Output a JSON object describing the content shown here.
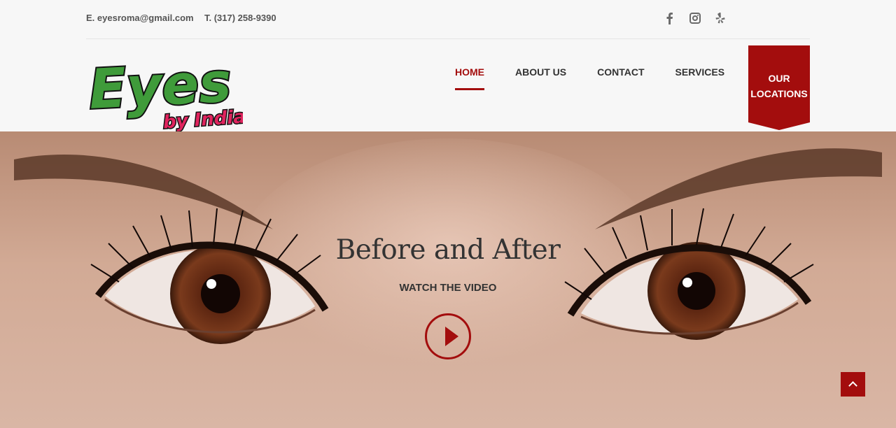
{
  "topbar": {
    "email": "E. eyesroma@gmail.com",
    "phone": "T. (317) 258-9390",
    "social_icons": [
      "facebook-icon",
      "instagram-icon",
      "yelp-icon"
    ]
  },
  "logo": {
    "main": "Eyes",
    "sub": "by India"
  },
  "nav": {
    "items": [
      {
        "label": "HOME",
        "active": true
      },
      {
        "label": "ABOUT US",
        "active": false
      },
      {
        "label": "CONTACT",
        "active": false
      },
      {
        "label": "SERVICES",
        "active": false
      }
    ],
    "locations_line1": "OUR",
    "locations_line2": "LOCATIONS"
  },
  "hero": {
    "title": "Before and After",
    "subtitle": "WATCH THE VIDEO"
  },
  "colors": {
    "accent": "#a30d0d",
    "logo_green": "#3f9b3a",
    "logo_pink": "#e0245e"
  }
}
